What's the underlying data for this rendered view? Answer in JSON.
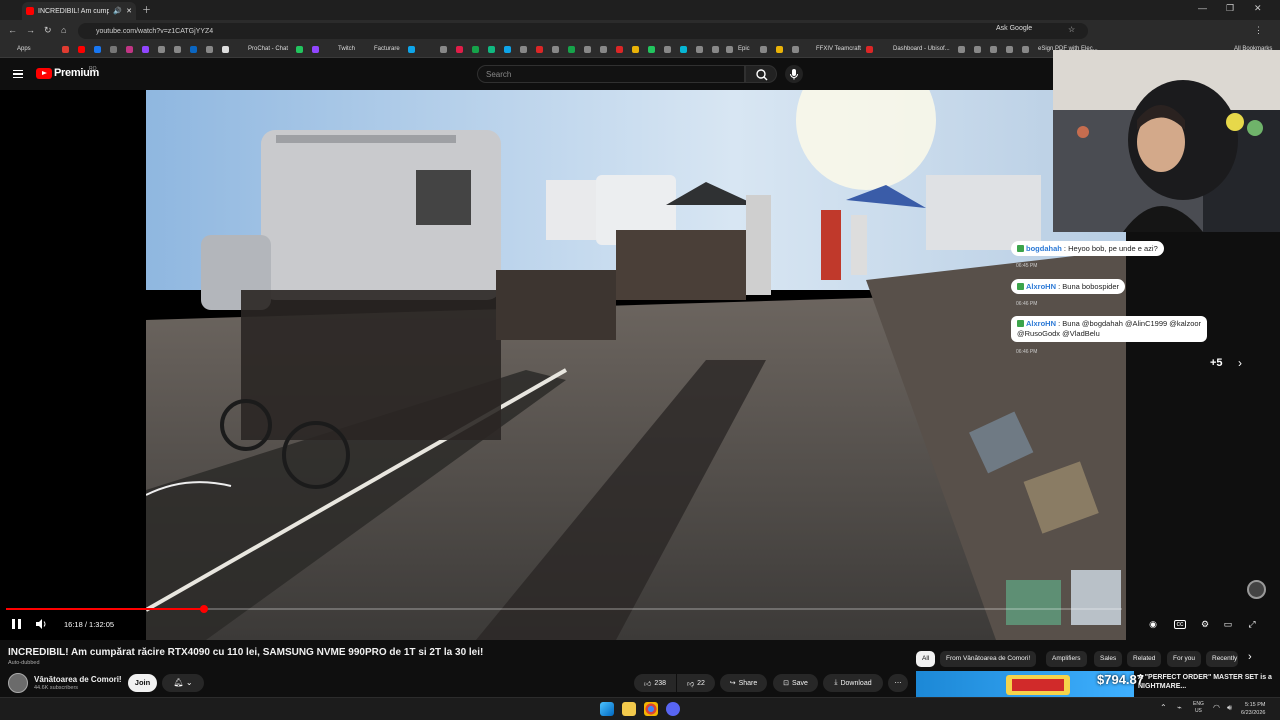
{
  "browser": {
    "tab_title": "INCREDIBIL! Am cumpărat r...",
    "url": "youtube.com/watch?v=z1CATGjYYZ4",
    "ask_google": "Ask Google",
    "bookmarks": [
      "Apps",
      "ProChat - Chat",
      "Twitch",
      "Facturare",
      "Epic",
      "FFXIV Teamcraft",
      "Dashboard - Ubisof...",
      "eSign PDF with Elec...",
      "All Bookmarks"
    ]
  },
  "youtube": {
    "logo_text": "Premium",
    "logo_region": "RO",
    "search_placeholder": "Search"
  },
  "player": {
    "time": "16:18 / 1:32:05",
    "progress": 0.177
  },
  "chat": [
    {
      "user": "bogdahah",
      "message": "Heyoo bob, pe unde e azi?",
      "time": "06:45 PM"
    },
    {
      "user": "AlxroHN",
      "message": "Buna bobospider",
      "time": "06:46 PM"
    },
    {
      "user": "AlxroHN",
      "message_line1": "Buna @bogdahah @AlinC1999 @kalzoor",
      "message_line2": "@RusoGodx @VladBelu",
      "time": "06:46 PM"
    }
  ],
  "chat_more": "+5",
  "video": {
    "title": "INCREDIBIL! Am cumpărat răcire RTX4090 cu 110 lei, SAMSUNG NVME 990PRO de 1T si 2T la 30 lei!",
    "auto_dubbed": "Auto-dubbed",
    "channel": "Vânătoarea de Comori!",
    "subscribers": "44.6K subscribers",
    "join_label": "Join",
    "likes": "238",
    "dislikes": "22",
    "share_label": "Share",
    "save_label": "Save",
    "download_label": "Download"
  },
  "chips": [
    "All",
    "From Vânătoarea de Comori!",
    "Amplifiers",
    "Sales",
    "Related",
    "For you",
    "Recently"
  ],
  "recommended": {
    "price_text": "$794.87",
    "title": "A \"PERFECT ORDER\" MASTER SET is a NIGHTMARE..."
  },
  "taskbar": {
    "lang1": "ENG",
    "lang2": "US",
    "time": "5:15 PM",
    "date": "6/23/2026"
  }
}
